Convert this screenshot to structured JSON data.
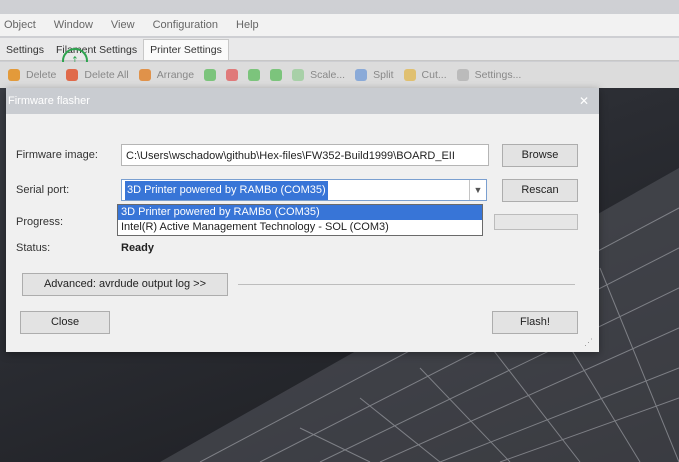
{
  "menu": [
    "Object",
    "Window",
    "View",
    "Configuration",
    "Help"
  ],
  "tabs": [
    "Settings",
    "Filament Settings",
    "Printer Settings"
  ],
  "toolbar": [
    "Delete",
    "Delete All",
    "Arrange",
    "Scale...",
    "Split",
    "Cut...",
    "Settings..."
  ],
  "dialog": {
    "title": "Firmware flasher",
    "firmware_label": "Firmware image:",
    "firmware_value": "C:\\Users\\wschadow\\github\\Hex-files\\FW352-Build1999\\BOARD_EII",
    "browse": "Browse",
    "serial_label": "Serial port:",
    "serial_value": "3D Printer powered by RAMBo (COM35)",
    "rescan": "Rescan",
    "options": [
      "3D Printer powered by RAMBo (COM35)",
      "Intel(R) Active Management Technology - SOL (COM3)"
    ],
    "progress_label": "Progress:",
    "status_label": "Status:",
    "status_value": "Ready",
    "advanced": "Advanced: avrdude output log >>",
    "close": "Close",
    "flash": "Flash!"
  },
  "colors": {
    "accent": "#3875d7",
    "logo": "#2ea44f"
  }
}
